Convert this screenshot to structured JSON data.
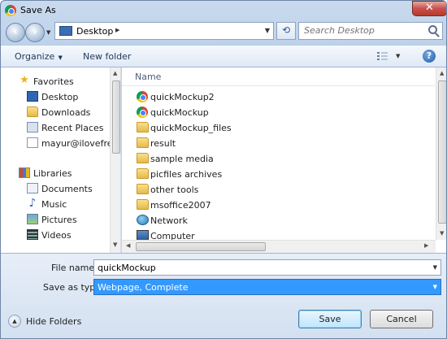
{
  "window": {
    "title": "Save As",
    "close_glyph": "✕"
  },
  "address": {
    "location": "Desktop",
    "separator_glyph": "▶",
    "dropdown_glyph": "▼"
  },
  "search": {
    "placeholder": "Search Desktop"
  },
  "toolbar": {
    "organize_label": "Organize",
    "new_folder_label": "New folder",
    "help_glyph": "?"
  },
  "navpane": {
    "favorites_label": "Favorites",
    "favorites": [
      "Desktop",
      "Downloads",
      "Recent Places",
      "mayur@ilovefrees"
    ],
    "libraries_label": "Libraries",
    "libraries": [
      "Documents",
      "Music",
      "Pictures",
      "Videos"
    ]
  },
  "filelist": {
    "column_name": "Name",
    "items": [
      {
        "name": "quickMockup2",
        "icon": "chrome-icon"
      },
      {
        "name": "quickMockup",
        "icon": "chrome-icon"
      },
      {
        "name": "quickMockup_files",
        "icon": "folder-icon"
      },
      {
        "name": "result",
        "icon": "folder-icon"
      },
      {
        "name": "sample media",
        "icon": "folder-icon"
      },
      {
        "name": "picfiles archives",
        "icon": "folder-icon"
      },
      {
        "name": "other tools",
        "icon": "folder-icon"
      },
      {
        "name": "msoffice2007",
        "icon": "folder-icon"
      },
      {
        "name": "Network",
        "icon": "network-icon"
      },
      {
        "name": "Computer",
        "icon": "computer-icon"
      }
    ]
  },
  "form": {
    "file_name_label": "File name:",
    "file_name_value": "quickMockup",
    "save_as_type_label": "Save as type:",
    "save_as_type_value": "Webpage, Complete"
  },
  "footer": {
    "hide_folders_label": "Hide Folders",
    "save_label": "Save",
    "cancel_label": "Cancel"
  },
  "colors": {
    "selection": "#3399ff",
    "frame": "#bcd1ea",
    "close_button": "#c75050"
  }
}
